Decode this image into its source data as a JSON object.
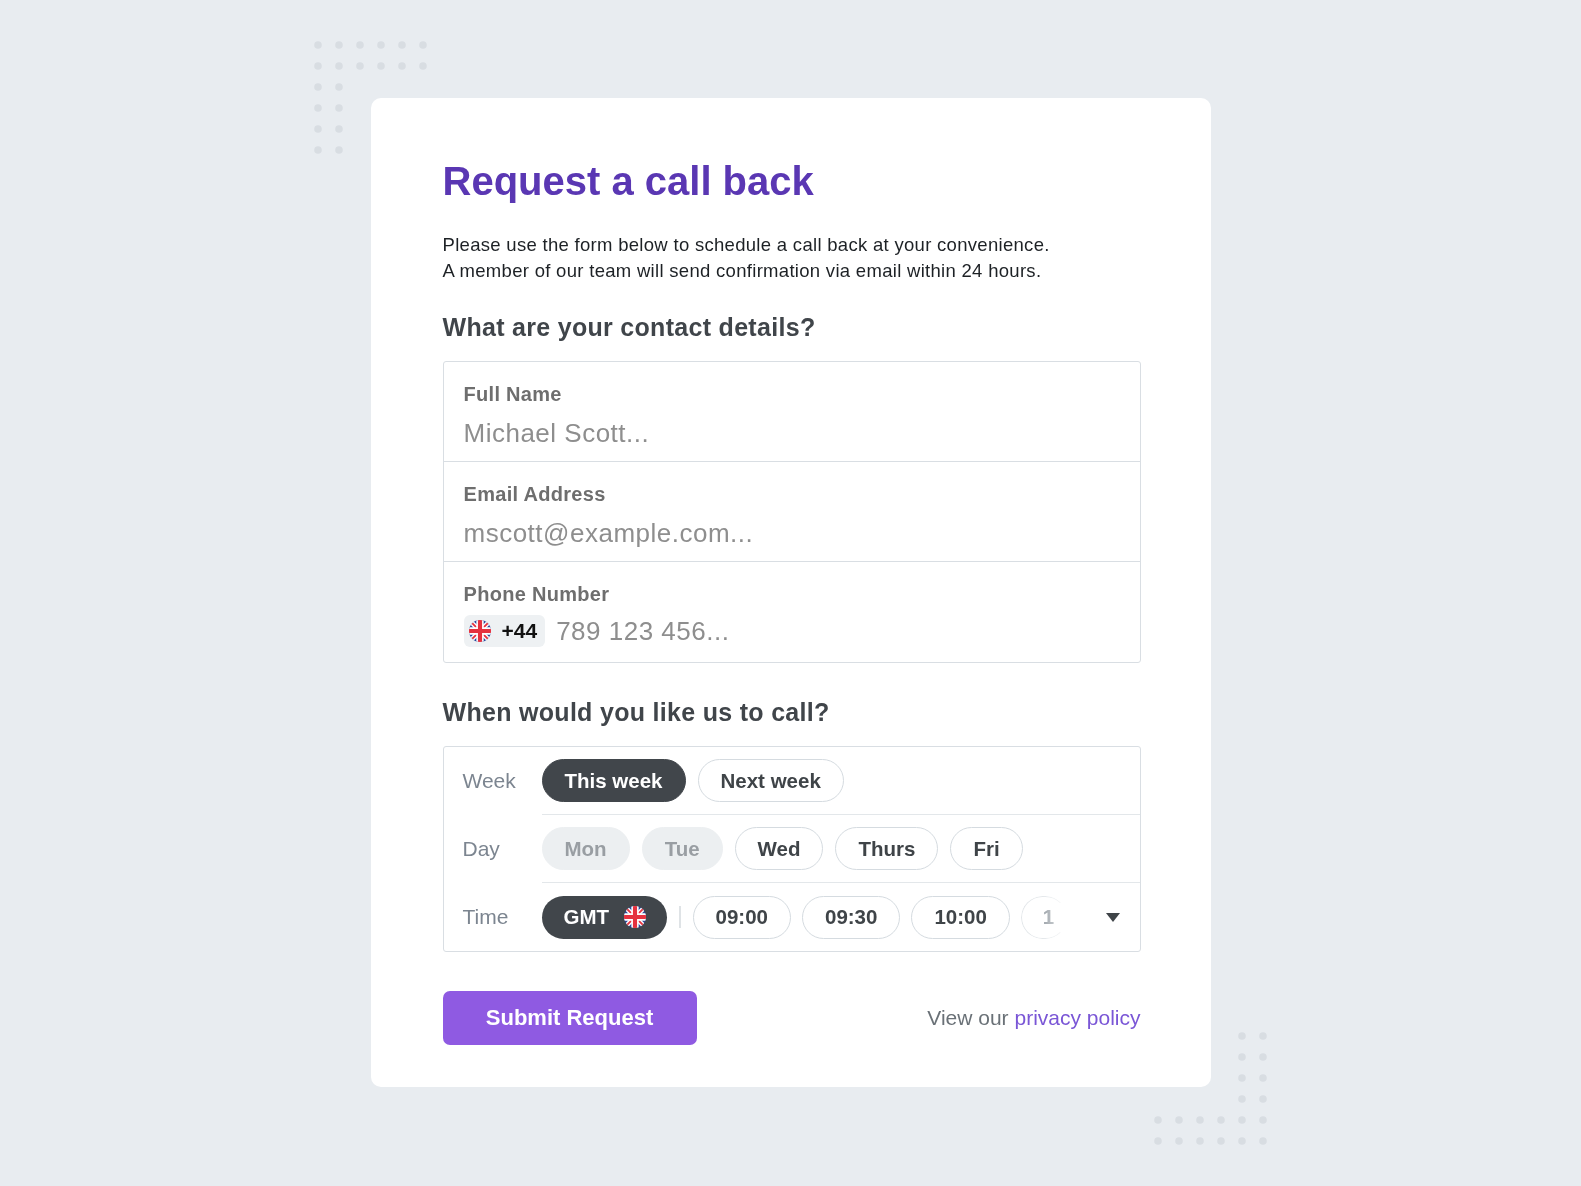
{
  "card": {
    "title": "Request a call back",
    "intro": [
      "Please use the form below to schedule a call back at your convenience.",
      "A member of our team will send confirmation via email within 24 hours."
    ]
  },
  "contact": {
    "heading": "What are your contact details?",
    "fields": [
      {
        "kind": "text",
        "label": "Full Name",
        "placeholder": "Michael Scott..."
      },
      {
        "kind": "text",
        "label": "Email Address",
        "placeholder": "mscott@example.com..."
      },
      {
        "kind": "phone",
        "label": "Phone Number",
        "country_code": "+44",
        "placeholder": "789 123 456..."
      }
    ]
  },
  "schedule": {
    "heading": "When would you like us to call?",
    "rows": [
      {
        "kind": "week",
        "label": "Week",
        "options": [
          {
            "label": "This week",
            "selected": true
          },
          {
            "label": "Next week",
            "selected": false
          }
        ]
      },
      {
        "kind": "day",
        "label": "Day",
        "options": [
          {
            "label": "Mon",
            "selected": false,
            "disabled": true
          },
          {
            "label": "Tue",
            "selected": false,
            "disabled": true
          },
          {
            "label": "Wed",
            "selected": false,
            "disabled": false
          },
          {
            "label": "Thurs",
            "selected": false,
            "disabled": false
          },
          {
            "label": "Fri",
            "selected": false,
            "disabled": false
          }
        ]
      },
      {
        "kind": "time",
        "label": "Time",
        "timezone": "GMT",
        "options": [
          {
            "label": "09:00",
            "selected": false,
            "faded": false
          },
          {
            "label": "09:30",
            "selected": false,
            "faded": false
          },
          {
            "label": "10:00",
            "selected": false,
            "faded": false
          },
          {
            "label": "1",
            "selected": false,
            "faded": true
          }
        ]
      }
    ]
  },
  "footer": {
    "submit": "Submit Request",
    "privacy_text": "View our",
    "privacy_link": "privacy policy"
  }
}
